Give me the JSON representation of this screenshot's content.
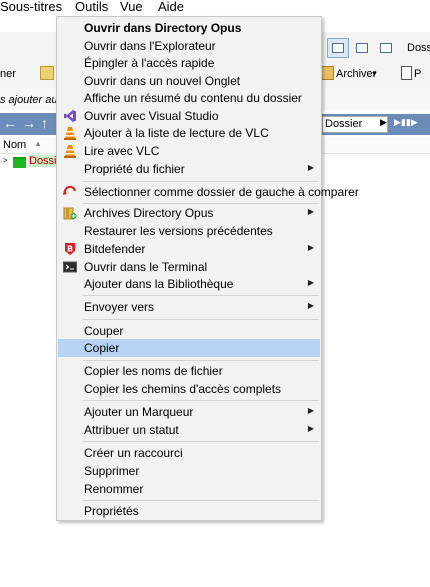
{
  "menubar": [
    "Sous-titres",
    "Outils",
    "Vue",
    "Aide"
  ],
  "background": {
    "toolbar_right_label": "Dossi",
    "toolbar2_left": "ner",
    "archiver_label": "Archiver",
    "properties_partial": "P",
    "hint_text": "s ajouter aux",
    "path_label": "Dossier",
    "column_header": "Nom",
    "row_label": "Dossie"
  },
  "context_menu": {
    "items": [
      {
        "label": "Ouvrir dans Directory Opus",
        "bold": true,
        "icon": "none"
      },
      {
        "label": "Ouvrir dans l'Explorateur",
        "icon": "none"
      },
      {
        "label": "Épingler à l'accès rapide",
        "icon": "none"
      },
      {
        "label": "Ouvrir dans un nouvel Onglet",
        "icon": "none"
      },
      {
        "label": "Affiche un résumé du contenu du dossier",
        "icon": "none"
      },
      {
        "label": "Ouvrir avec Visual Studio",
        "icon": "visual-studio-icon"
      },
      {
        "label": "Ajouter à la liste de lecture de VLC",
        "icon": "vlc-icon"
      },
      {
        "label": "Lire avec VLC",
        "icon": "vlc-icon"
      },
      {
        "label": "Propriété du fichier",
        "submenu": true,
        "icon": "none"
      },
      {
        "label": "Sélectionner comme dossier de gauche à comparer",
        "icon": "compare-icon"
      },
      {
        "label": "Archives Directory Opus",
        "submenu": true,
        "icon": "archive-icon"
      },
      {
        "label": "Restaurer les versions précédentes",
        "icon": "none"
      },
      {
        "label": "Bitdefender",
        "submenu": true,
        "icon": "bitdefender-icon"
      },
      {
        "label": "Ouvrir dans le Terminal",
        "icon": "terminal-icon"
      },
      {
        "label": "Ajouter dans la Bibliothèque",
        "submenu": true,
        "icon": "none"
      },
      {
        "label": "Envoyer vers",
        "submenu": true,
        "icon": "none"
      },
      {
        "label": "Couper",
        "icon": "none"
      },
      {
        "label": "Copier",
        "highlighted": true,
        "icon": "none"
      },
      {
        "label": "Copier les noms de fichier",
        "icon": "none"
      },
      {
        "label": "Copier les chemins d'accès complets",
        "icon": "none"
      },
      {
        "label": "Ajouter un Marqueur",
        "submenu": true,
        "icon": "none"
      },
      {
        "label": "Attribuer un statut",
        "submenu": true,
        "icon": "none"
      },
      {
        "label": "Créer un raccourci",
        "icon": "none"
      },
      {
        "label": "Supprimer",
        "icon": "none"
      },
      {
        "label": "Renommer",
        "icon": "none"
      },
      {
        "label": "Propriétés",
        "icon": "none"
      }
    ]
  },
  "colors": {
    "highlight": "#b8d4f5",
    "menu_bg": "#f2f2f2",
    "nav_blue": "#6b8bb8",
    "folder_green": "#1fb81f"
  }
}
